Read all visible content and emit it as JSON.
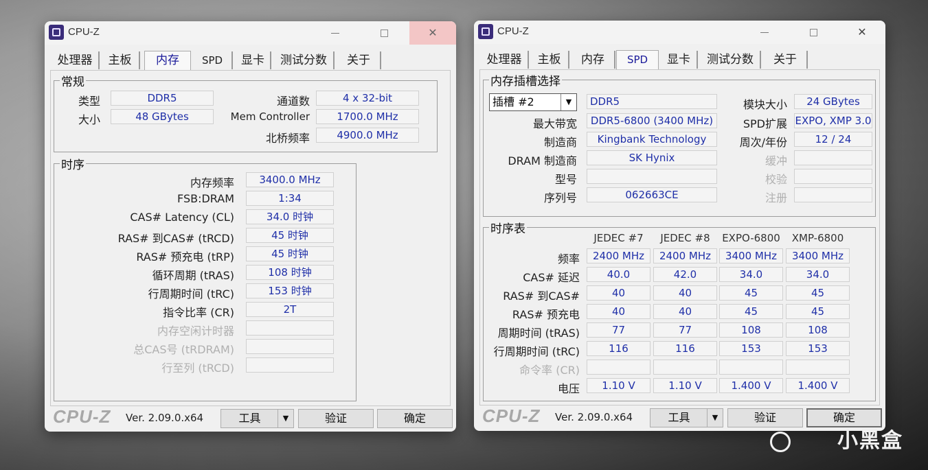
{
  "app_title": "CPU-Z",
  "tabs": [
    "处理器",
    "主板",
    "内存",
    "SPD",
    "显卡",
    "测试分数",
    "关于"
  ],
  "left": {
    "active_tab": "内存",
    "general": {
      "title": "常规",
      "type_label": "类型",
      "type": "DDR5",
      "size_label": "大小",
      "size": "48 GBytes",
      "channels_label": "通道数",
      "channels": "4 x 32-bit",
      "memctrl_label": "Mem Controller",
      "memctrl": "1700.0 MHz",
      "nb_label": "北桥频率",
      "nb": "4900.0 MHz"
    },
    "timings": {
      "title": "时序",
      "rows": [
        {
          "label": "内存频率",
          "value": "3400.0 MHz",
          "dim": false
        },
        {
          "label": "FSB:DRAM",
          "value": "1:34",
          "dim": false
        },
        {
          "label": "CAS# Latency (CL)",
          "value": "34.0 时钟",
          "dim": false
        },
        {
          "label": "RAS# 到CAS# (tRCD)",
          "value": "45 时钟",
          "dim": false
        },
        {
          "label": "RAS# 预充电 (tRP)",
          "value": "45 时钟",
          "dim": false
        },
        {
          "label": "循环周期 (tRAS)",
          "value": "108 时钟",
          "dim": false
        },
        {
          "label": "行周期时间 (tRC)",
          "value": "153 时钟",
          "dim": false
        },
        {
          "label": "指令比率 (CR)",
          "value": "2T",
          "dim": false
        },
        {
          "label": "内存空闲计时器",
          "value": "",
          "dim": true
        },
        {
          "label": "总CAS号 (tRDRAM)",
          "value": "",
          "dim": true
        },
        {
          "label": "行至列 (tRCD)",
          "value": "",
          "dim": true
        }
      ]
    }
  },
  "right": {
    "active_tab": "SPD",
    "slot": {
      "title": "内存插槽选择",
      "selected": "插槽 #2",
      "type": "DDR5",
      "module_size_label": "模块大小",
      "module_size": "24 GBytes",
      "maxbw_label": "最大带宽",
      "maxbw": "DDR5-6800 (3400 MHz)",
      "spdext_label": "SPD扩展",
      "spdext": "EXPO, XMP 3.0",
      "mfr_label": "制造商",
      "mfr": "Kingbank Technology",
      "week_label": "周次/年份",
      "week": "12 / 24",
      "dram_label": "DRAM 制造商",
      "dram": "SK Hynix",
      "buffer_label": "缓冲",
      "buffer": "",
      "part_label": "型号",
      "part": "",
      "check_label": "校验",
      "check": "",
      "serial_label": "序列号",
      "serial": "062663CE",
      "reg_label": "注册",
      "reg": ""
    },
    "timing_table": {
      "title": "时序表",
      "columns": [
        "JEDEC #7",
        "JEDEC #8",
        "EXPO-6800",
        "XMP-6800"
      ],
      "rows": [
        {
          "label": "频率",
          "values": [
            "2400 MHz",
            "2400 MHz",
            "3400 MHz",
            "3400 MHz"
          ],
          "dim": false
        },
        {
          "label": "CAS# 延迟",
          "values": [
            "40.0",
            "42.0",
            "34.0",
            "34.0"
          ],
          "dim": false
        },
        {
          "label": "RAS# 到CAS#",
          "values": [
            "40",
            "40",
            "45",
            "45"
          ],
          "dim": false
        },
        {
          "label": "RAS# 预充电",
          "values": [
            "40",
            "40",
            "45",
            "45"
          ],
          "dim": false
        },
        {
          "label": "周期时间 (tRAS)",
          "values": [
            "77",
            "77",
            "108",
            "108"
          ],
          "dim": false
        },
        {
          "label": "行周期时间 (tRC)",
          "values": [
            "116",
            "116",
            "153",
            "153"
          ],
          "dim": false
        },
        {
          "label": "命令率 (CR)",
          "values": [
            "",
            "",
            "",
            ""
          ],
          "dim": true
        },
        {
          "label": "电压",
          "values": [
            "1.10 V",
            "1.10 V",
            "1.400 V",
            "1.400 V"
          ],
          "dim": false
        }
      ]
    }
  },
  "bottom": {
    "logo": "CPU-Z",
    "version": "Ver. 2.09.0.x64",
    "tools": "工具",
    "validate": "验证",
    "ok": "确定"
  },
  "watermark": "小黑盒",
  "icons": {
    "app": "cpuz-chip-icon",
    "dropdown": "chevron-down-icon",
    "watermark": "heybox-logo-icon"
  }
}
